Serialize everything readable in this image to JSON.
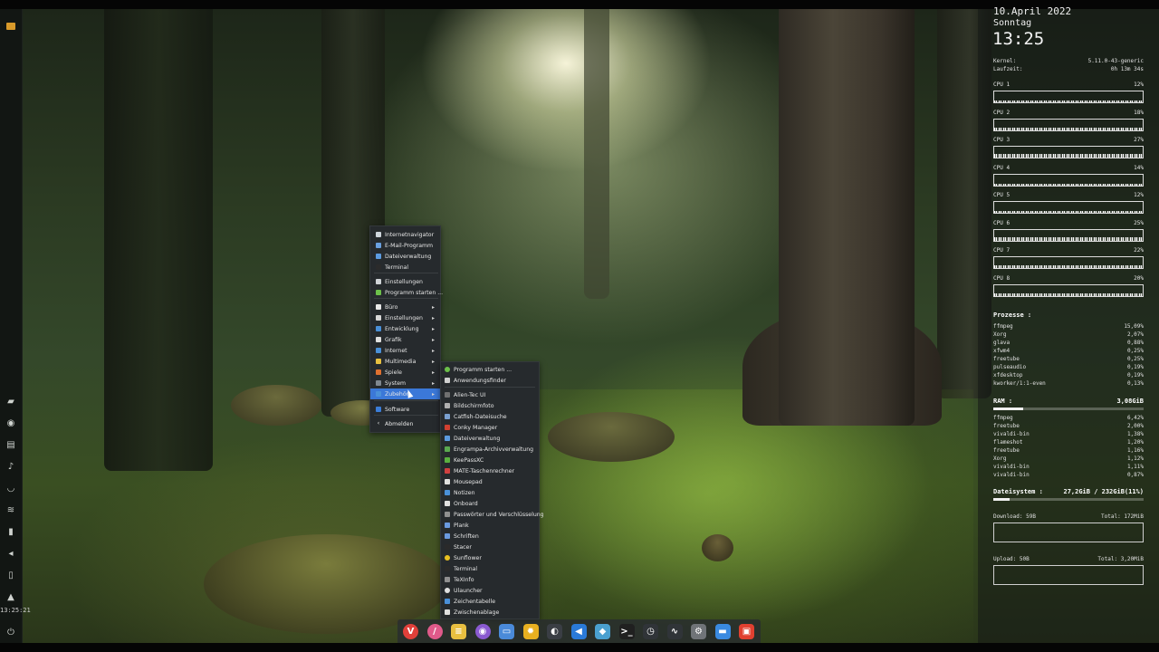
{
  "left_panel": {
    "clock": "13:25:21",
    "icons": [
      "app-menu-icon",
      "network-icon",
      "files-icon",
      "media-icon",
      "headphones-icon",
      "wifi-icon",
      "battery-icon",
      "volume-icon",
      "clipboard-icon",
      "notification-icon",
      "power-icon"
    ]
  },
  "menu": {
    "items": [
      {
        "label": "Internetnavigator",
        "icon": "browser-icon",
        "color": "#cfd6dd",
        "submenu": false
      },
      {
        "label": "E-Mail-Programm",
        "icon": "mail-icon",
        "color": "#6aa0e0",
        "submenu": false
      },
      {
        "label": "Dateiverwaltung",
        "icon": "folder-icon",
        "color": "#5c9be0",
        "submenu": false
      },
      {
        "label": "Terminal",
        "icon": "terminal-icon",
        "color": "#2b2b2b",
        "submenu": false
      },
      {
        "label": "Einstellungen",
        "icon": "settings-icon",
        "color": "#d0d4d8",
        "submenu": false
      },
      {
        "label": "Programm starten ...",
        "icon": "run-icon",
        "color": "#6cc04a",
        "submenu": false
      },
      {
        "label": "Büro",
        "icon": "office-icon",
        "color": "#e8e8e8",
        "submenu": true
      },
      {
        "label": "Einstellungen",
        "icon": "settings-category-icon",
        "color": "#d8d8d8",
        "submenu": true
      },
      {
        "label": "Entwicklung",
        "icon": "development-icon",
        "color": "#4a90d9",
        "submenu": true
      },
      {
        "label": "Grafik",
        "icon": "graphics-icon",
        "color": "#e0e0e0",
        "submenu": true
      },
      {
        "label": "Internet",
        "icon": "internet-icon",
        "color": "#4a90d9",
        "submenu": true
      },
      {
        "label": "Multimedia",
        "icon": "multimedia-icon",
        "color": "#e8c040",
        "submenu": true
      },
      {
        "label": "Spiele",
        "icon": "games-icon",
        "color": "#e07030",
        "submenu": true
      },
      {
        "label": "System",
        "icon": "system-icon",
        "color": "#808890",
        "submenu": true
      },
      {
        "label": "Zubehör",
        "icon": "accessories-icon",
        "color": "#4a90d9",
        "submenu": true,
        "selected": true
      },
      {
        "label": "Software",
        "icon": "software-icon",
        "color": "#3b7dd8",
        "submenu": false
      },
      {
        "label": "Abmelden",
        "icon": "logout-icon",
        "color": "#e0e0e0",
        "submenu": false
      }
    ]
  },
  "submenu": {
    "items": [
      {
        "label": "Programm starten ...",
        "icon": "run-icon",
        "color": "#6cc04a"
      },
      {
        "label": "Anwendungsfinder",
        "icon": "search-icon",
        "color": "#d0d0d0"
      },
      {
        "label": "Alien-Tec UI",
        "icon": "alien-tec-icon",
        "color": "#707070"
      },
      {
        "label": "Bildschirmfoto",
        "icon": "screenshot-icon",
        "color": "#b0b0b0"
      },
      {
        "label": "Catfish-Dateisuche",
        "icon": "catfish-icon",
        "color": "#7aa0d0"
      },
      {
        "label": "Conky Manager",
        "icon": "conky-icon",
        "color": "#d04030"
      },
      {
        "label": "Dateiverwaltung",
        "icon": "folder-icon",
        "color": "#5c9be0"
      },
      {
        "label": "Engrampa-Archivverwaltung",
        "icon": "archive-icon",
        "color": "#5aa850"
      },
      {
        "label": "KeePassXC",
        "icon": "keepass-icon",
        "color": "#5ab040"
      },
      {
        "label": "MATE-Taschenrechner",
        "icon": "calculator-icon",
        "color": "#d04040"
      },
      {
        "label": "Mousepad",
        "icon": "mousepad-icon",
        "color": "#e0e0e0"
      },
      {
        "label": "Notizen",
        "icon": "notes-icon",
        "color": "#4a90d9"
      },
      {
        "label": "Onboard",
        "icon": "keyboard-icon",
        "color": "#e0e0e0"
      },
      {
        "label": "Passwörter und Verschlüsselung",
        "icon": "passwords-icon",
        "color": "#909090"
      },
      {
        "label": "Plank",
        "icon": "plank-icon",
        "color": "#6a9ae0"
      },
      {
        "label": "Schriften",
        "icon": "fonts-icon",
        "color": "#6a9ae0"
      },
      {
        "label": "Stacer",
        "icon": "stacer-icon",
        "color": "#2a2a2a"
      },
      {
        "label": "Sunflower",
        "icon": "sunflower-icon",
        "color": "#e8c020"
      },
      {
        "label": "Terminal",
        "icon": "terminal-icon",
        "color": "#2b2b2b"
      },
      {
        "label": "TeXInfo",
        "icon": "texinfo-icon",
        "color": "#909090"
      },
      {
        "label": "Ulauncher",
        "icon": "ulauncher-icon",
        "color": "#e0e0e0"
      },
      {
        "label": "Zeichentabelle",
        "icon": "charmap-icon",
        "color": "#4a90d9"
      },
      {
        "label": "Zwischenablage",
        "icon": "clipboard-icon",
        "color": "#e0e0e0"
      }
    ]
  },
  "conky": {
    "date": "10.April 2022",
    "day": "Sonntag",
    "time": "13:25",
    "kernel_label": "Kernel:",
    "kernel": "5.11.0-43-generic",
    "uptime_label": "Laufzeit:",
    "uptime": "0h 13m 34s",
    "cpus": [
      {
        "label": "CPU 1",
        "value": "12%"
      },
      {
        "label": "CPU 2",
        "value": "18%"
      },
      {
        "label": "CPU 3",
        "value": "27%"
      },
      {
        "label": "CPU 4",
        "value": "14%"
      },
      {
        "label": "CPU 5",
        "value": "12%"
      },
      {
        "label": "CPU 6",
        "value": "25%"
      },
      {
        "label": "CPU 7",
        "value": "22%"
      },
      {
        "label": "CPU 8",
        "value": "20%"
      }
    ],
    "processes_header": "Prozesse :",
    "processes": [
      {
        "name": "ffmpeg",
        "value": "15,09%"
      },
      {
        "name": "Xorg",
        "value": "2,07%"
      },
      {
        "name": "glava",
        "value": "0,88%"
      },
      {
        "name": "xfwm4",
        "value": "0,25%"
      },
      {
        "name": "freetube",
        "value": "0,25%"
      },
      {
        "name": "pulseaudio",
        "value": "0,19%"
      },
      {
        "name": "xfdesktop",
        "value": "0,19%"
      },
      {
        "name": "kworker/1:1-even",
        "value": "0,13%"
      }
    ],
    "ram_header": "RAM :",
    "ram_value": "3,08GiB",
    "ram_fraction": 0.2,
    "ram_processes": [
      {
        "name": "ffmpeg",
        "value": "6,42%"
      },
      {
        "name": "freetube",
        "value": "2,00%"
      },
      {
        "name": "vivaldi-bin",
        "value": "1,38%"
      },
      {
        "name": "flameshot",
        "value": "1,20%"
      },
      {
        "name": "freetube",
        "value": "1,16%"
      },
      {
        "name": "Xorg",
        "value": "1,12%"
      },
      {
        "name": "vivaldi-bin",
        "value": "1,11%"
      },
      {
        "name": "vivaldi-bin",
        "value": "0,87%"
      }
    ],
    "fs_header": "Dateisystem :",
    "fs_value": "27,2GiB / 232GiB(11%)",
    "fs_fraction": 0.11,
    "download_label": "Download: 59B",
    "download_total": "Total: 172MiB",
    "upload_label": "Upload: 50B",
    "upload_total": "Total: 3,20MiB"
  },
  "dock": {
    "icons": [
      {
        "name": "vivaldi-icon",
        "color": "#e0403a",
        "glyph": "V"
      },
      {
        "name": "app-red-icon",
        "color": "#e05a8a",
        "glyph": "/"
      },
      {
        "name": "notes-app-icon",
        "color": "#e8c040",
        "glyph": "≡"
      },
      {
        "name": "podcast-icon",
        "color": "#8a5ad0",
        "glyph": "◉"
      },
      {
        "name": "files-icon",
        "color": "#4a8ad8",
        "glyph": "▭"
      },
      {
        "name": "sunflower-icon",
        "color": "#e8b020",
        "glyph": "✹"
      },
      {
        "name": "steam-icon",
        "color": "#3a3e44",
        "glyph": "◐"
      },
      {
        "name": "vscode-icon",
        "color": "#2a7ad8",
        "glyph": "◀"
      },
      {
        "name": "stack-icon",
        "color": "#4aa0d0",
        "glyph": "◆"
      },
      {
        "name": "terminal-icon",
        "color": "#202020",
        "glyph": ">_"
      },
      {
        "name": "clock-icon",
        "color": "#303438",
        "glyph": "◷"
      },
      {
        "name": "system-monitor-icon",
        "color": "#303438",
        "glyph": "∿"
      },
      {
        "name": "settings-icon",
        "color": "#707478",
        "glyph": "⚙"
      },
      {
        "name": "folder-icon",
        "color": "#3a8ae0",
        "glyph": "▬"
      },
      {
        "name": "flameshot-icon",
        "color": "#e04030",
        "glyph": "▣"
      }
    ]
  }
}
